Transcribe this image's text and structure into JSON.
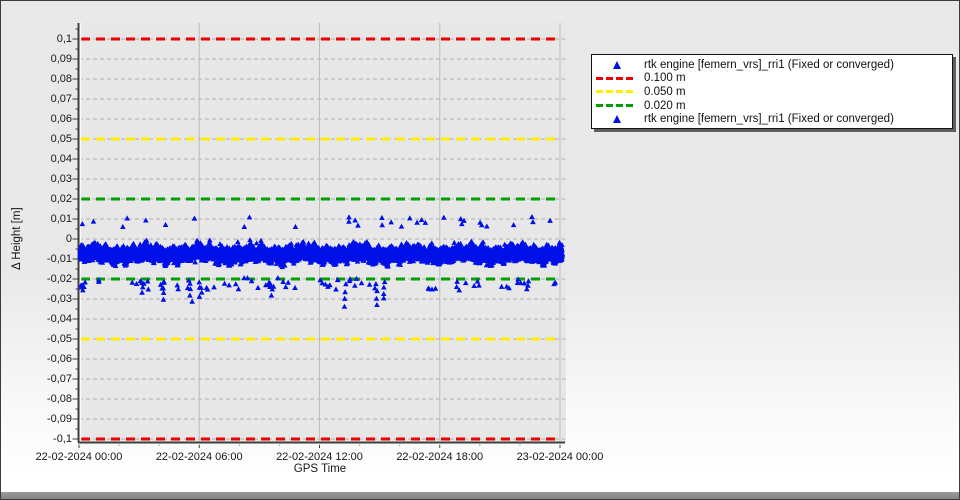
{
  "colors": {
    "window_bg_top": "#e9e9e9",
    "window_bg_bottom": "#ffffff",
    "plot_bg": "#e7e7e7",
    "grid_line": "#aeaeae",
    "vertical_grid_line": "#bdbdbd",
    "axis_line": "#3f3f3f",
    "axis_highlight": "#fafafa",
    "tick_text": "#161616",
    "series_blue": "#0010e8",
    "ref_red": "#ee0000",
    "ref_yellow": "#ffee00",
    "ref_green": "#00a000",
    "legend_bg": "#ffffff",
    "legend_border": "#141414",
    "legend_shadow": "#5f5f5f",
    "bottom_bar": "#8e8e8e"
  },
  "chart_data": {
    "type": "scatter",
    "title": "",
    "xlabel": "GPS Time",
    "ylabel": "Δ Height [m]",
    "x_axis": {
      "range_hours": [
        0,
        24.25
      ],
      "minor_tick_every_hours": 2,
      "ticks": [
        {
          "hour": 0,
          "label": "22-02-2024 00:00"
        },
        {
          "hour": 6,
          "label": "22-02-2024 06:00"
        },
        {
          "hour": 12,
          "label": "22-02-2024 12:00"
        },
        {
          "hour": 18,
          "label": "22-02-2024 18:00"
        },
        {
          "hour": 24,
          "label": "23-02-2024 00:00"
        }
      ]
    },
    "y_axis": {
      "range": [
        -0.1015,
        0.108
      ],
      "minor_tick_step": 0.005,
      "ticks": [
        {
          "value": 0.1,
          "label": "0,1"
        },
        {
          "value": 0.09,
          "label": "0,09"
        },
        {
          "value": 0.08,
          "label": "0,08"
        },
        {
          "value": 0.07,
          "label": "0,07"
        },
        {
          "value": 0.06,
          "label": "0,06"
        },
        {
          "value": 0.05,
          "label": "0,05"
        },
        {
          "value": 0.04,
          "label": "0,04"
        },
        {
          "value": 0.03,
          "label": "0,03"
        },
        {
          "value": 0.02,
          "label": "0,02"
        },
        {
          "value": 0.01,
          "label": "0,01"
        },
        {
          "value": 0,
          "label": "0"
        },
        {
          "value": -0.01,
          "label": "-0,01"
        },
        {
          "value": -0.02,
          "label": "-0,02"
        },
        {
          "value": -0.03,
          "label": "-0,03"
        },
        {
          "value": -0.04,
          "label": "-0,04"
        },
        {
          "value": -0.05,
          "label": "-0,05"
        },
        {
          "value": -0.06,
          "label": "-0,06"
        },
        {
          "value": -0.07,
          "label": "-0,07"
        },
        {
          "value": -0.08,
          "label": "-0,08"
        },
        {
          "value": -0.09,
          "label": "-0,09"
        },
        {
          "value": -0.1,
          "label": "-0,1"
        }
      ]
    },
    "grid": {
      "horizontal": "dashed",
      "vertical": "solid"
    },
    "reference_lines": [
      {
        "label": "0.100 m",
        "values": [
          0.1,
          -0.1
        ],
        "color": "#ee0000",
        "style": "dashed"
      },
      {
        "label": "0.050 m",
        "values": [
          0.05,
          -0.05
        ],
        "color": "#ffee00",
        "style": "dashed"
      },
      {
        "label": "0.020 m",
        "values": [
          0.02,
          -0.02
        ],
        "color": "#00a000",
        "style": "dashed"
      }
    ],
    "series": [
      {
        "name": "rtk engine [femern_vrs]_rri1 (Fixed or converged)",
        "marker": "triangle",
        "color": "#0010e8",
        "x_range_hours": [
          0.05,
          24.1
        ],
        "band_stats": {
          "mean": -0.0075,
          "sigma": 0.0055,
          "dense_range": [
            -0.02,
            0.005
          ],
          "ridge_peak_max": 0.012,
          "min": -0.035
        },
        "notable_outliers": [
          {
            "hour": 0.25,
            "value": -0.026
          },
          {
            "hour": 3.2,
            "value": -0.027
          },
          {
            "hour": 4.2,
            "value": -0.03
          },
          {
            "hour": 5.6,
            "value": -0.031
          },
          {
            "hour": 6.05,
            "value": -0.029
          },
          {
            "hour": 9.6,
            "value": -0.028
          },
          {
            "hour": 13.3,
            "value": -0.034
          },
          {
            "hour": 14.8,
            "value": -0.033
          },
          {
            "hour": 15.2,
            "value": -0.03
          },
          {
            "hour": 18.9,
            "value": -0.026
          },
          {
            "hour": 19.05,
            "value": 0.01
          },
          {
            "hour": 22.4,
            "value": -0.025
          },
          {
            "hour": 22.6,
            "value": 0.011
          }
        ]
      }
    ]
  },
  "legend": {
    "items": [
      {
        "type": "marker",
        "color": "#0010e8",
        "label": "rtk engine [femern_vrs]_rri1 (Fixed or converged)"
      },
      {
        "type": "dash",
        "color": "#ee0000",
        "label": "0.100 m"
      },
      {
        "type": "dash",
        "color": "#ffee00",
        "label": "0.050 m"
      },
      {
        "type": "dash",
        "color": "#00a000",
        "label": "0.020 m"
      },
      {
        "type": "marker",
        "color": "#0010e8",
        "label": "rtk engine [femern_vrs]_rri1 (Fixed or converged)"
      }
    ]
  }
}
